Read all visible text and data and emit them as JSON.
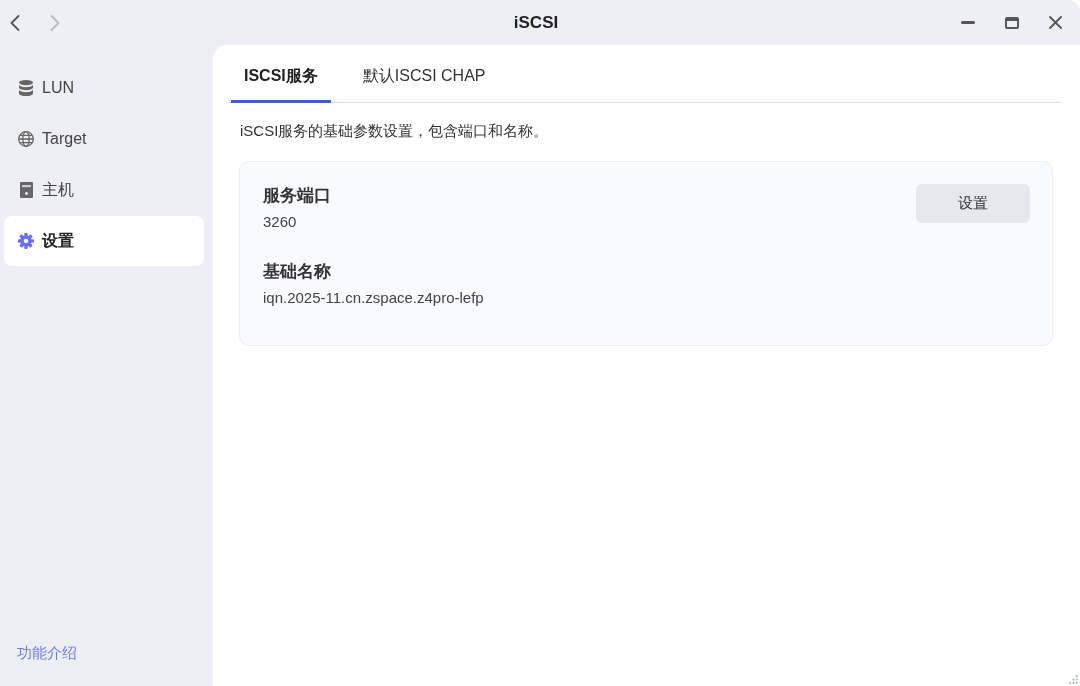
{
  "window": {
    "title": "iSCSI",
    "nav": [
      {
        "kind": "back",
        "disabled": false
      },
      {
        "kind": "forward",
        "disabled": true
      }
    ],
    "controls": [
      {
        "kind": "minimize"
      },
      {
        "kind": "maximize"
      },
      {
        "kind": "close"
      }
    ]
  },
  "sidebar": {
    "items": [
      {
        "kind": "database",
        "label": "LUN",
        "selected": false
      },
      {
        "kind": "globe",
        "label": "Target",
        "selected": false
      },
      {
        "kind": "host",
        "label": "主机",
        "selected": false
      },
      {
        "kind": "gear",
        "label": "设置",
        "selected": true
      }
    ],
    "footer_link": "功能介绍"
  },
  "tabs": [
    {
      "label": "ISCSI服务",
      "selected": true
    },
    {
      "label": "默认ISCSI CHAP",
      "selected": false
    }
  ],
  "description": "iSCSI服务的基础参数设置，包含端口和名称。",
  "card": {
    "fields": [
      {
        "label": "服务端口",
        "value": "3260"
      },
      {
        "label": "基础名称",
        "value": "iqn.2025-11.cn.zspace.z4pro-lefp"
      }
    ],
    "button": "设置"
  }
}
